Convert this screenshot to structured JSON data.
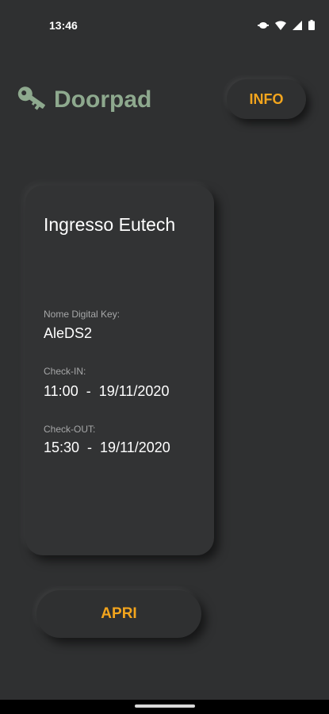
{
  "status_bar": {
    "time": "13:46",
    "icons": [
      "data-saver-icon",
      "wifi-icon",
      "cell-signal-icon",
      "battery-icon"
    ]
  },
  "header": {
    "app_name": "Doorpad",
    "logo_icon": "key-icon",
    "info_button": "INFO"
  },
  "card": {
    "title": "Ingresso Eutech",
    "digital_key_label": "Nome Digital Key:",
    "digital_key_value": "AleDS2",
    "checkin_label": "Check-IN:",
    "checkin_value": "11:00  -  19/11/2020",
    "checkout_label": "Check-OUT:",
    "checkout_value": "15:30  -  19/11/2020"
  },
  "actions": {
    "open_button": "APRI"
  },
  "colors": {
    "background": "#2f3031",
    "brand_green": "#8ea98e",
    "accent_orange": "#f3a51d"
  }
}
